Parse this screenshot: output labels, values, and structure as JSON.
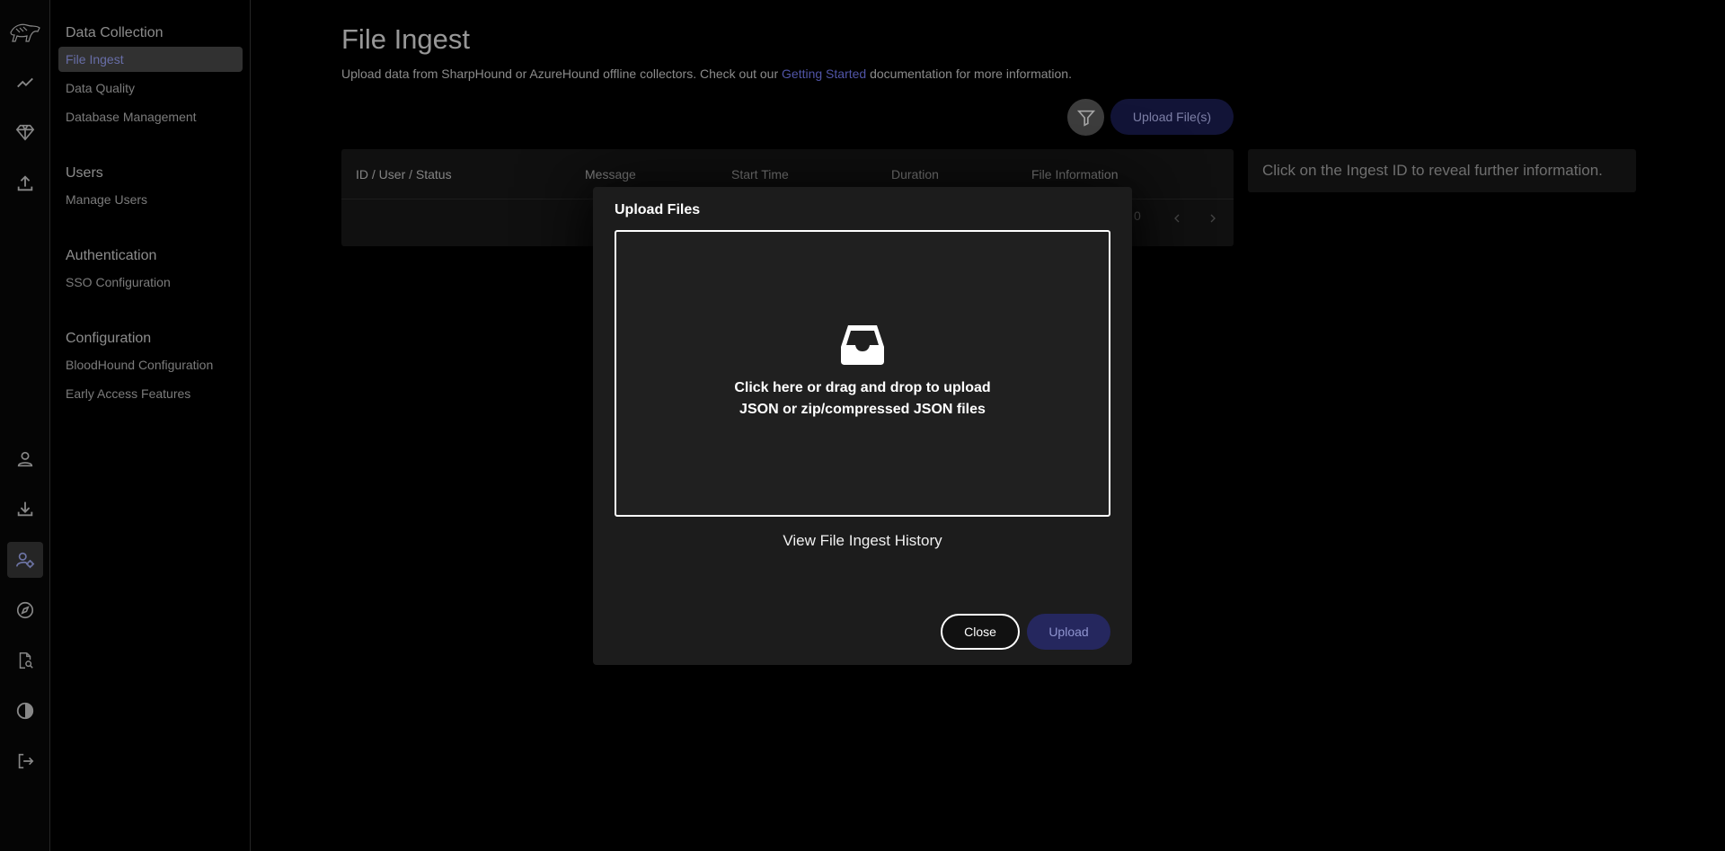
{
  "rail": {
    "items": [
      {
        "icon": "bloodhound-logo-icon"
      },
      {
        "icon": "trend-line-icon"
      },
      {
        "icon": "gem-icon"
      },
      {
        "icon": "upload-icon"
      },
      {
        "icon": "user-icon"
      },
      {
        "icon": "download-icon"
      },
      {
        "icon": "user-gear-icon"
      },
      {
        "icon": "compass-icon"
      },
      {
        "icon": "document-search-icon"
      },
      {
        "icon": "contrast-icon"
      },
      {
        "icon": "logout-icon"
      }
    ]
  },
  "nav": {
    "data_collection": {
      "heading": "Data Collection",
      "items": [
        "File Ingest",
        "Data Quality",
        "Database Management"
      ]
    },
    "users": {
      "heading": "Users",
      "items": [
        "Manage Users"
      ]
    },
    "authentication": {
      "heading": "Authentication",
      "items": [
        "SSO Configuration"
      ]
    },
    "configuration": {
      "heading": "Configuration",
      "items": [
        "BloodHound Configuration",
        "Early Access Features"
      ]
    }
  },
  "page": {
    "title": "File Ingest",
    "desc_pre": "Upload data from SharpHound or AzureHound offline collectors. Check out our ",
    "desc_link": "Getting Started",
    "desc_post": " documentation for more information.",
    "upload_files_label": "Upload File(s)"
  },
  "table": {
    "columns": [
      "ID / User / Status",
      "Message",
      "Start Time",
      "Duration",
      "File Information"
    ],
    "pagination_text": "0"
  },
  "info_panel": {
    "text": "Click on the Ingest ID to reveal further information."
  },
  "modal": {
    "title": "Upload Files",
    "dropzone_line1": "Click here or drag and drop to upload",
    "dropzone_line2": "JSON or zip/compressed JSON files",
    "history_link": "View File Ingest History",
    "close_label": "Close",
    "upload_label": "Upload"
  },
  "colors": {
    "accent": "#7b82ff",
    "primary_button": "#1d1f55",
    "active_nav_bg": "#4c4c4c"
  }
}
